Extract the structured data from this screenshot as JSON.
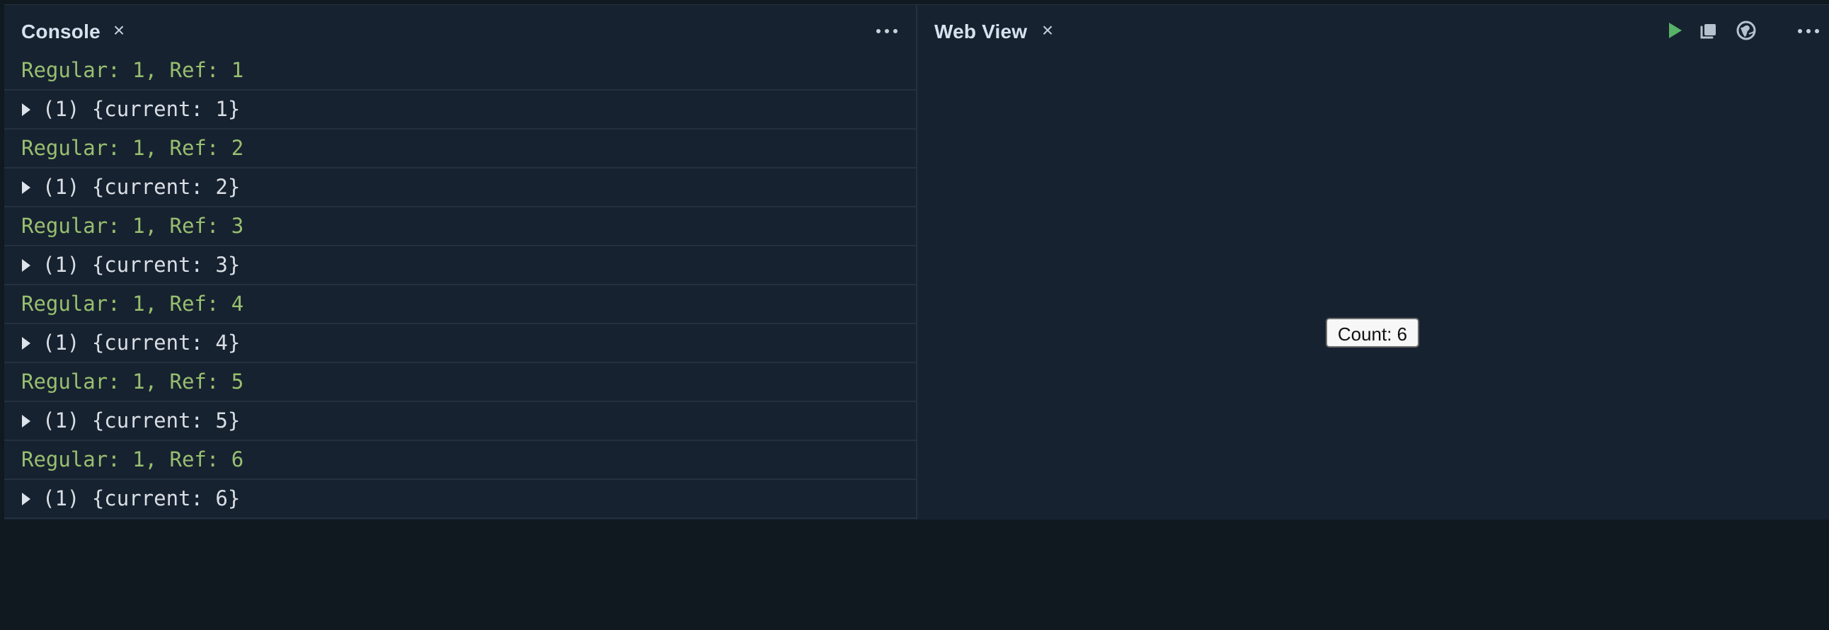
{
  "console": {
    "title": "Console",
    "close_icon": "close-icon",
    "more_icon": "more-horizontal-icon",
    "entries": [
      {
        "type": "log",
        "text": "Regular: 1, Ref: 1"
      },
      {
        "type": "object",
        "text": "(1) {current: 1}"
      },
      {
        "type": "log",
        "text": "Regular: 1, Ref: 2"
      },
      {
        "type": "object",
        "text": "(1) {current: 2}"
      },
      {
        "type": "log",
        "text": "Regular: 1, Ref: 3"
      },
      {
        "type": "object",
        "text": "(1) {current: 3}"
      },
      {
        "type": "log",
        "text": "Regular: 1, Ref: 4"
      },
      {
        "type": "object",
        "text": "(1) {current: 4}"
      },
      {
        "type": "log",
        "text": "Regular: 1, Ref: 5"
      },
      {
        "type": "object",
        "text": "(1) {current: 5}"
      },
      {
        "type": "log",
        "text": "Regular: 1, Ref: 6"
      },
      {
        "type": "object",
        "text": "(1) {current: 6}"
      }
    ]
  },
  "webview": {
    "title": "Web View",
    "close_icon": "close-icon",
    "toolbar_icons": [
      "play-icon",
      "popout-icon",
      "globe-icon",
      "more-horizontal-icon"
    ],
    "count_button_label": "Count: 6"
  },
  "colors": {
    "background": "#172230",
    "log_text": "#98bf6f",
    "object_text": "#d9dee5",
    "run_icon": "#58b368"
  }
}
